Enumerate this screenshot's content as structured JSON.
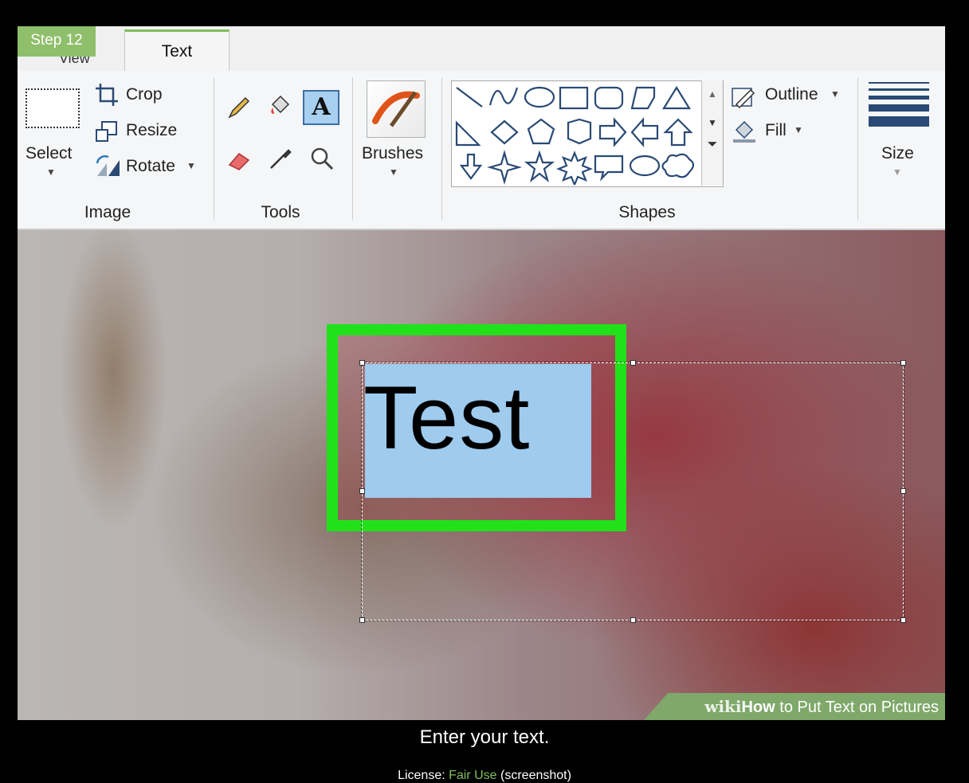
{
  "step_badge": "Step 12",
  "tabs": {
    "view": "View",
    "text": "Text"
  },
  "ribbon": {
    "image": {
      "label": "Image",
      "select": "Select",
      "crop": "Crop",
      "resize": "Resize",
      "rotate": "Rotate"
    },
    "tools": {
      "label": "Tools"
    },
    "brushes": {
      "label": "Brushes"
    },
    "shapes": {
      "label": "Shapes",
      "outline": "Outline",
      "fill": "Fill"
    },
    "size": {
      "label": "Size"
    }
  },
  "canvas": {
    "text_value": "Test"
  },
  "watermark": {
    "wiki": "wiki",
    "how": "How",
    "rest": " to Put Text on Pictures"
  },
  "caption": "Enter your text.",
  "license": {
    "prefix": "License: ",
    "link": "Fair Use",
    "suffix": " (screenshot)"
  },
  "colors": {
    "highlight": "#21e21a",
    "text_fill": "#9ecbee",
    "accent": "#7fbf5a"
  }
}
